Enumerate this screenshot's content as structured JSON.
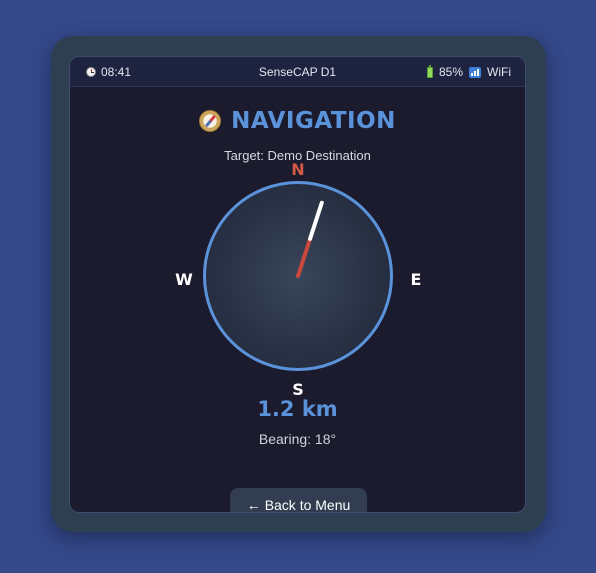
{
  "status_bar": {
    "time": "08:41",
    "device_name": "SenseCAP D1",
    "battery": "85%",
    "network": "WiFi",
    "icons": [
      "clock-icon",
      "battery-icon",
      "signal-icon"
    ]
  },
  "header": {
    "icon": "compass-icon",
    "title": "NAVIGATION"
  },
  "target": "Target: Demo Destination",
  "compass": {
    "north": "N",
    "south": "S",
    "east": "E",
    "west": "W",
    "heading_deg": 18,
    "north_color": "#d35945",
    "ring_color": "#5b93db"
  },
  "distance": "1.2 km",
  "bearing": "Bearing: 18°",
  "back_button": {
    "arrow": "←",
    "label": "Back to Menu"
  },
  "colors": {
    "background": "#34488a",
    "bezel": "#2e3f52",
    "screen": "#1b1b2d",
    "accent": "#5b93db"
  }
}
